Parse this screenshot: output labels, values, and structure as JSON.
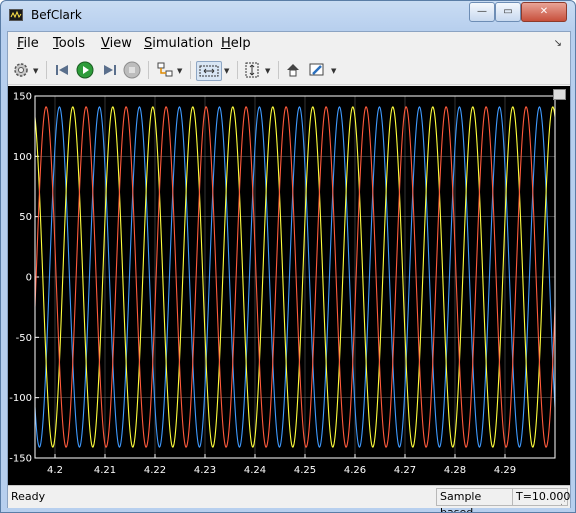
{
  "window": {
    "title": "BefClark"
  },
  "menu": [
    {
      "key": "file",
      "label": "File",
      "mnemonic": "F",
      "rest": "ile"
    },
    {
      "key": "tools",
      "label": "Tools",
      "mnemonic": "T",
      "rest": "ools"
    },
    {
      "key": "view",
      "label": "View",
      "mnemonic": "V",
      "rest": "iew"
    },
    {
      "key": "simulation",
      "label": "Simulation",
      "mnemonic": "S",
      "rest": "imulation"
    },
    {
      "key": "help",
      "label": "Help",
      "mnemonic": "H",
      "rest": "elp"
    }
  ],
  "toolbar": {
    "icons": [
      "gear-icon",
      "step-back-icon",
      "run-icon",
      "step-forward-icon",
      "stop-icon",
      "signal-select-icon",
      "zoom-x-icon",
      "scale-y-icon",
      "highlight-block-icon",
      "style-icon"
    ]
  },
  "status": {
    "ready": "Ready",
    "mode": "Sample based",
    "time": "T=10.000"
  },
  "chart_data": {
    "type": "line",
    "background": "#000000",
    "axes_color": "#ffffff",
    "grid": true,
    "xlim": [
      4.196,
      4.3
    ],
    "ylim": [
      -150,
      150
    ],
    "xticks": [
      4.2,
      4.21,
      4.22,
      4.23,
      4.24,
      4.25,
      4.26,
      4.27,
      4.28,
      4.29
    ],
    "xtick_labels": [
      "4.2",
      "4.21",
      "4.22",
      "4.23",
      "4.24",
      "4.25",
      "4.26",
      "4.27",
      "4.28",
      "4.29"
    ],
    "yticks": [
      -150,
      -100,
      -50,
      0,
      50,
      100,
      150
    ],
    "ytick_labels": [
      "-150",
      "-100",
      "-50",
      "0",
      "50",
      "100",
      "150"
    ],
    "series": [
      {
        "color": "#3f9bff",
        "amplitude": 141,
        "frequency_hz": 125,
        "phase_deg": 50
      },
      {
        "color": "#ffff3c",
        "amplitude": 141,
        "frequency_hz": 125,
        "phase_deg": -70
      },
      {
        "color": "#ff5a3c",
        "amplitude": 141,
        "frequency_hz": 125,
        "phase_deg": 170
      }
    ]
  }
}
